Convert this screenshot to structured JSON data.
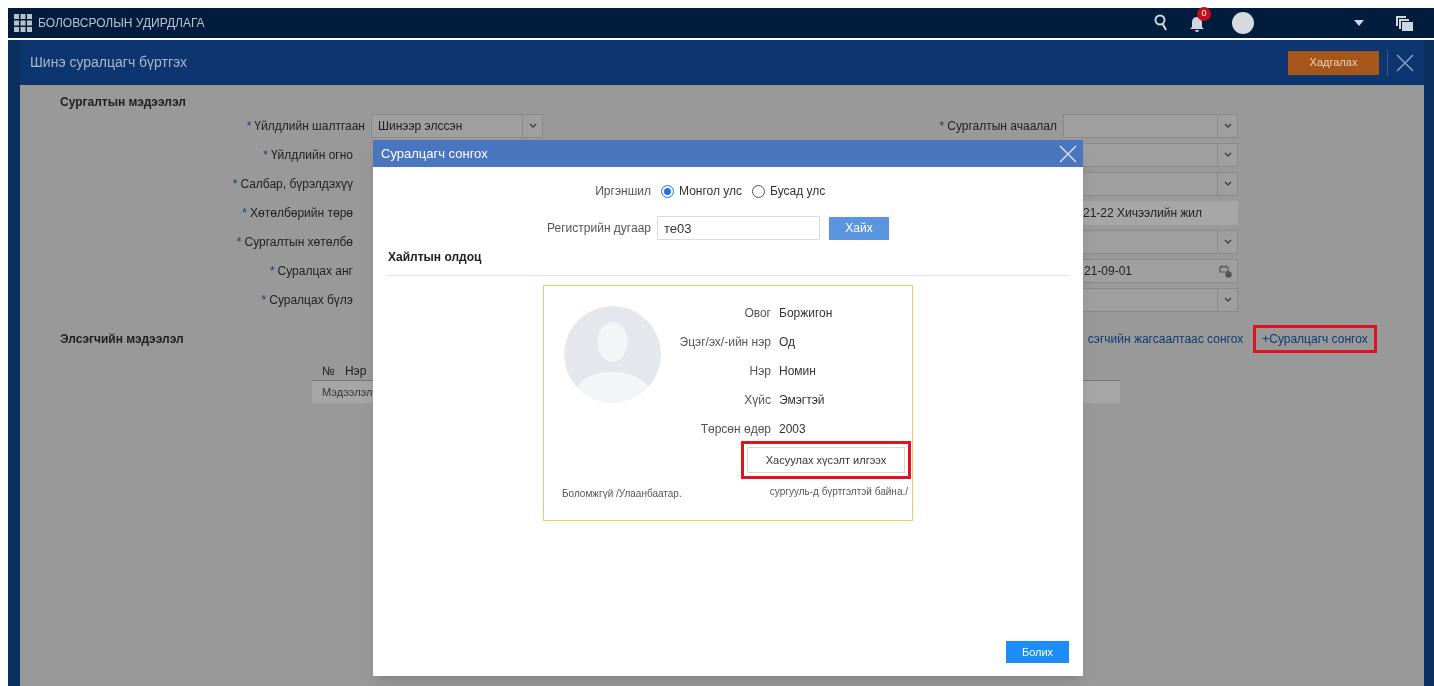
{
  "top_bar": {
    "app_title": "БОЛОВСРОЛЫН УДИРДЛАГА",
    "notification_count": "0"
  },
  "page": {
    "title": "Шинэ суралцагч бүртгэх",
    "save_button": "Хадгалах"
  },
  "training_section": {
    "title": "Сургалтын мэдээлэл",
    "left_fields": [
      {
        "label": "Үйлдлийн шалтгаан",
        "required_mark": "*",
        "kind": "select",
        "value": "Шинээр элссэн"
      },
      {
        "label": "Үйлдлийн огно",
        "required_mark": "*"
      },
      {
        "label": "Салбар, бүрэлдэхүү",
        "required_mark": "*"
      },
      {
        "label": "Хөтөлбөрийн төрө",
        "required_mark": "*"
      },
      {
        "label": "Сургалтын хөтөлбө",
        "required_mark": "*"
      },
      {
        "label": "Суралцах анг",
        "required_mark": "*"
      },
      {
        "label": "Суралцах бүлэ",
        "required_mark": "*"
      }
    ],
    "right_fields": [
      {
        "label": "Сургалтын ачаалал",
        "required_mark": "*",
        "kind": "select"
      },
      {
        "kind": "select"
      },
      {
        "kind": "select"
      },
      {
        "kind": "text",
        "value": "21-22 Хичээлийн жил"
      },
      {
        "kind": "select"
      },
      {
        "kind": "date",
        "value": "21-09-01"
      },
      {
        "kind": "select"
      }
    ]
  },
  "applicant_section": {
    "title": "Элсэгчийн мэдээлэл",
    "list_link": "сэгчийн жагсаалтаас сонгох",
    "add_button": {
      "label": "+Суралцагч сонгох",
      "highlighted": true
    },
    "table": {
      "columns": [
        "№",
        "Нэр"
      ],
      "rows": [
        [
          "Мэдээлэл"
        ]
      ]
    }
  },
  "modal": {
    "title": "Суралцагч сонгох",
    "citizenship": {
      "label": "Иргэншил",
      "options": [
        {
          "label": "Монгол улс",
          "selected": true
        },
        {
          "label": "Бусад улс",
          "selected": false
        }
      ]
    },
    "register": {
      "label": "Регистрийн дугаар",
      "value": "те03"
    },
    "search_button": "Хайх",
    "results_title": "Хайлтын олдоц",
    "result": {
      "fields": [
        {
          "label": "Овог",
          "value": "Боржигон"
        },
        {
          "label": "Эцэг/эх/-ийн нэр",
          "value": "Од"
        },
        {
          "label": "Нэр",
          "value": "Номин"
        },
        {
          "label": "Хүйс",
          "value": "Эмэгтэй"
        },
        {
          "label": "Төрсөн өдөр",
          "value": "2003"
        }
      ],
      "request_button": {
        "label": "Хасуулах хүсэлт илгээх",
        "highlighted": true
      },
      "note_left": "Боломжгүй /Улаанбаатар.",
      "note_right": "сургууль-д бүртгэлтэй байна./"
    },
    "cancel_button": "Болих"
  }
}
